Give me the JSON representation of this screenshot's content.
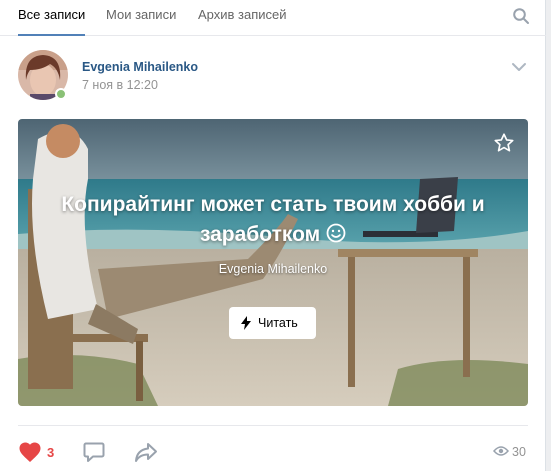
{
  "tabs": [
    {
      "label": "Все записи",
      "active": true
    },
    {
      "label": "Мои записи",
      "active": false
    },
    {
      "label": "Архив записей",
      "active": false
    }
  ],
  "post": {
    "author": "Evgenia Mihailenko",
    "date": "7 ноя в 12:20",
    "online": true,
    "article": {
      "title": "Копирайтинг может стать твоим хобби и заработком",
      "author": "Evgenia Mihailenko",
      "read_label": "Читать"
    },
    "likes": "3",
    "liked": true,
    "views": "30"
  },
  "icons": [
    "search-icon",
    "chevron-down-icon",
    "star-icon",
    "bolt-icon",
    "heart-icon",
    "comment-icon",
    "share-icon",
    "eye-icon"
  ],
  "colors": {
    "accent": "#5181b8",
    "link": "#2a5885",
    "like": "#e64646",
    "online": "#8ac176",
    "muted": "#939393"
  }
}
